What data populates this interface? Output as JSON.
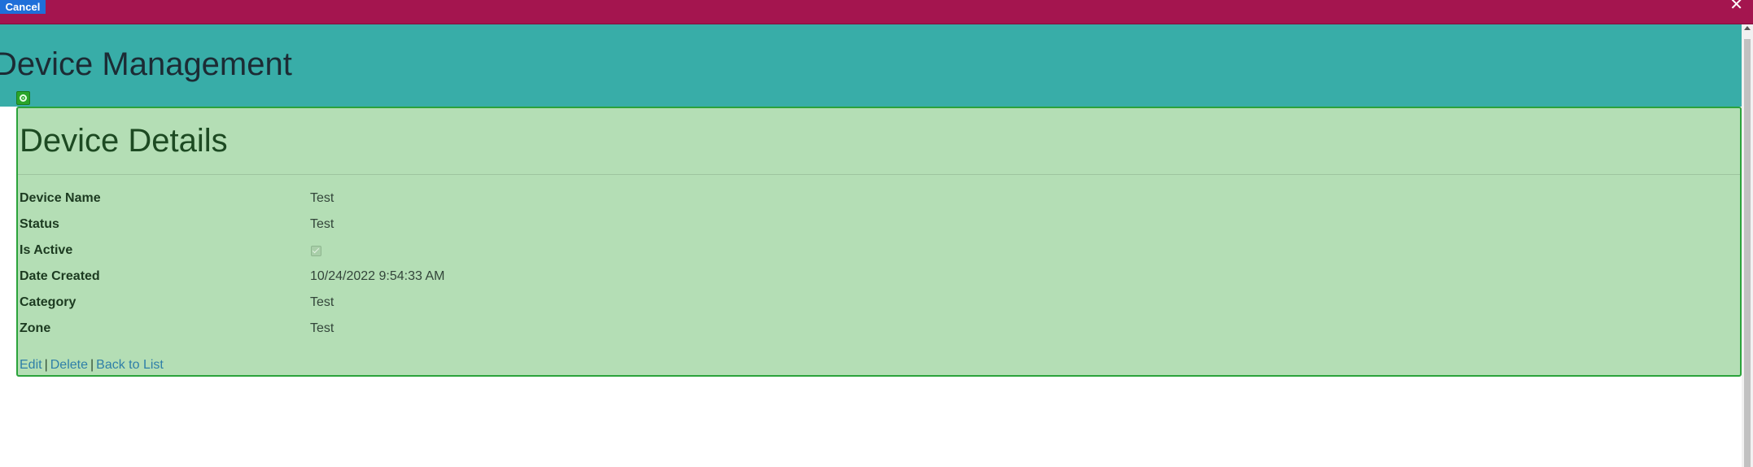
{
  "topbar": {
    "cancel_label": "Cancel",
    "close_glyph": "✕",
    "background": "#a4154f",
    "cancel_color": "#1f6fd9"
  },
  "header": {
    "title": "Device Management",
    "background": "#38ada8"
  },
  "panel": {
    "badge_icon": "target-icon",
    "title": "Device Details",
    "background": "#b4deb5",
    "border_color": "#2ba33b",
    "fields": [
      {
        "label": "Device Name",
        "value": "Test"
      },
      {
        "label": "Status",
        "value": "Test"
      },
      {
        "label": "Is Active",
        "checked": true
      },
      {
        "label": "Date Created",
        "value": "10/24/2022 9:54:33 AM"
      },
      {
        "label": "Category",
        "value": "Test"
      },
      {
        "label": "Zone",
        "value": "Test"
      }
    ],
    "actions": {
      "edit": "Edit",
      "delete": "Delete",
      "back": "Back to List",
      "separator": "|"
    }
  }
}
